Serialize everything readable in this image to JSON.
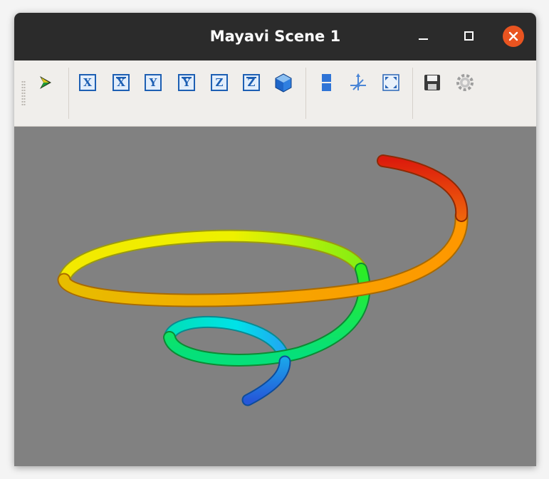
{
  "window": {
    "title": "Mayavi Scene 1",
    "controls": [
      {
        "name": "minimize",
        "icon": "minimize-icon"
      },
      {
        "name": "maximize",
        "icon": "maximize-icon"
      },
      {
        "name": "close",
        "icon": "close-icon",
        "color": "#e95420"
      }
    ]
  },
  "toolbar": {
    "buttons": [
      {
        "id": "mayavi-logo",
        "icon": "mayavi-logo-icon"
      },
      {
        "id": "view-x-plus",
        "label": "X"
      },
      {
        "id": "view-x-minus",
        "label": "X"
      },
      {
        "id": "view-y-plus",
        "label": "Y"
      },
      {
        "id": "view-y-minus",
        "label": "Y"
      },
      {
        "id": "view-z-plus",
        "label": "Z"
      },
      {
        "id": "view-z-minus",
        "label": "Z"
      },
      {
        "id": "view-isometric",
        "icon": "cube-icon"
      },
      {
        "id": "toggle-parallel-projection",
        "icon": "parallel-projection-icon"
      },
      {
        "id": "toggle-axes",
        "icon": "axes-icon"
      },
      {
        "id": "full-screen",
        "icon": "fullscreen-icon"
      },
      {
        "id": "save-snapshot",
        "icon": "save-icon"
      },
      {
        "id": "configure-scene",
        "icon": "gear-icon"
      }
    ]
  },
  "scene": {
    "background_color": "#818181",
    "object": "3D tube spiral (helix) colored by height",
    "colormap": [
      "#2a6ee0",
      "#00e4ee",
      "#19ee22",
      "#eef000",
      "#ffa800",
      "#e21400"
    ]
  }
}
